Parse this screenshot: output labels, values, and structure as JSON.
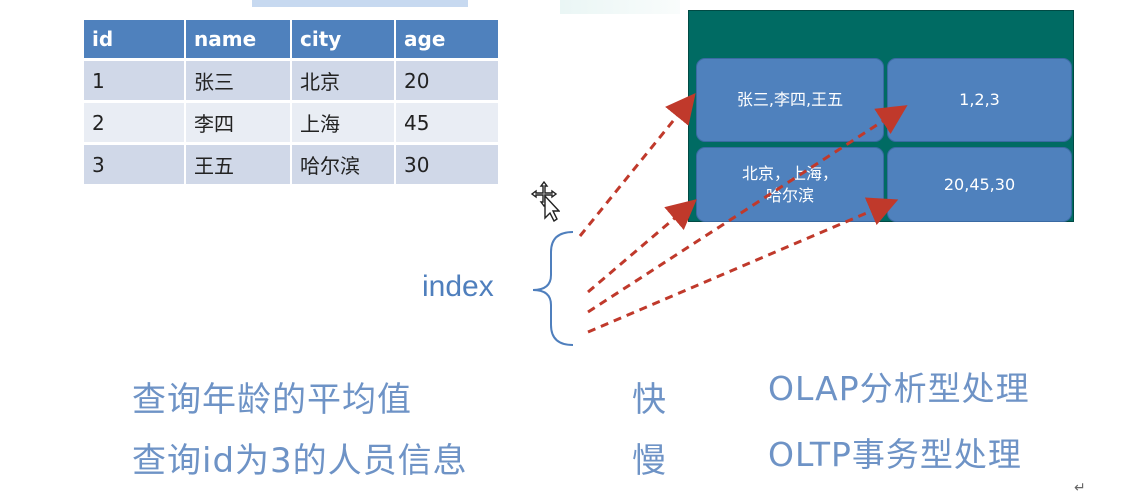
{
  "table": {
    "headers": [
      "id",
      "name",
      "city",
      "age"
    ],
    "rows": [
      [
        "1",
        "张三",
        "北京",
        "20"
      ],
      [
        "2",
        "李四",
        "上海",
        "45"
      ],
      [
        "3",
        "王五",
        "哈尔滨",
        "30"
      ]
    ]
  },
  "storage": {
    "cells": [
      "张三,李四,王五",
      "1,2,3",
      "北京，上海，\n哈尔滨",
      "20,45,30"
    ],
    "background": "#006b63",
    "cell_color": "#4f81bd"
  },
  "index": {
    "label": "index"
  },
  "queries": [
    {
      "text": "查询年龄的平均值",
      "speed": "快",
      "processing": "OLAP分析型处理"
    },
    {
      "text": "查询id为3的人员信息",
      "speed": "慢",
      "processing": "OLTP事务型处理"
    }
  ],
  "colors": {
    "header": "#4f81bd",
    "arrow": "#c0392b",
    "text_blue": "#6e93c6"
  },
  "icons": {
    "cursor": "move-cursor-icon",
    "return": "return-mark"
  },
  "return_mark": "↵"
}
